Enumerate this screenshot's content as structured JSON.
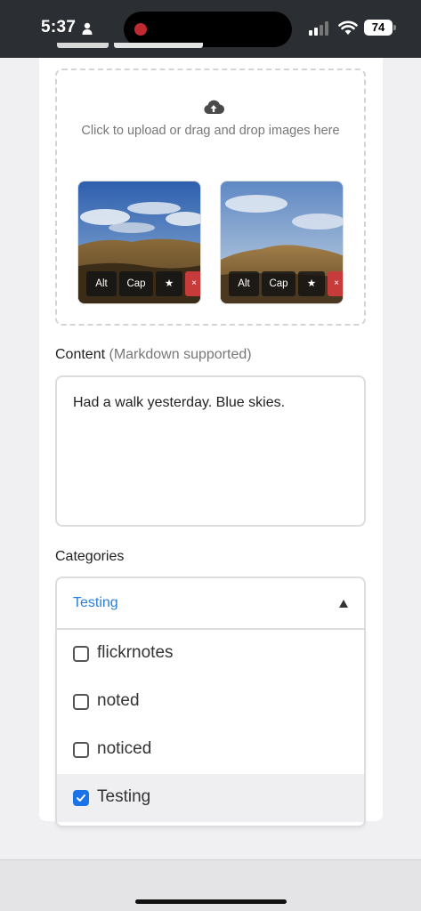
{
  "status": {
    "time": "5:37",
    "battery": "74",
    "icons": [
      "person-icon",
      "cellular-signal-icon",
      "wifi-icon",
      "battery-icon"
    ]
  },
  "form": {
    "upload": {
      "icon": "cloud-upload-icon",
      "text": "Click to upload or drag and drop images here",
      "images": [
        {
          "name": "landscape-photo-1",
          "buttons": {
            "alt": "Alt",
            "caption": "Cap",
            "feature": "★",
            "remove": "×"
          }
        },
        {
          "name": "landscape-photo-2",
          "buttons": {
            "alt": "Alt",
            "caption": "Cap",
            "feature": "★",
            "remove": "×"
          }
        }
      ]
    },
    "content": {
      "label": "Content",
      "hint": "(Markdown supported)",
      "value": "Had a walk yesterday. Blue skies."
    },
    "categories": {
      "label": "Categories",
      "selected_value": "Testing",
      "options": [
        {
          "label": "flickrnotes",
          "checked": false
        },
        {
          "label": "noted",
          "checked": false
        },
        {
          "label": "noticed",
          "checked": false
        },
        {
          "label": "Testing",
          "checked": true
        }
      ]
    }
  },
  "colors": {
    "accent": "#2a7fd4",
    "checkbox_checked": "#1a73e8",
    "delete_button": "#c73b3b",
    "status_bar": "#2b2f33",
    "recording_dot": "#c0292f"
  }
}
